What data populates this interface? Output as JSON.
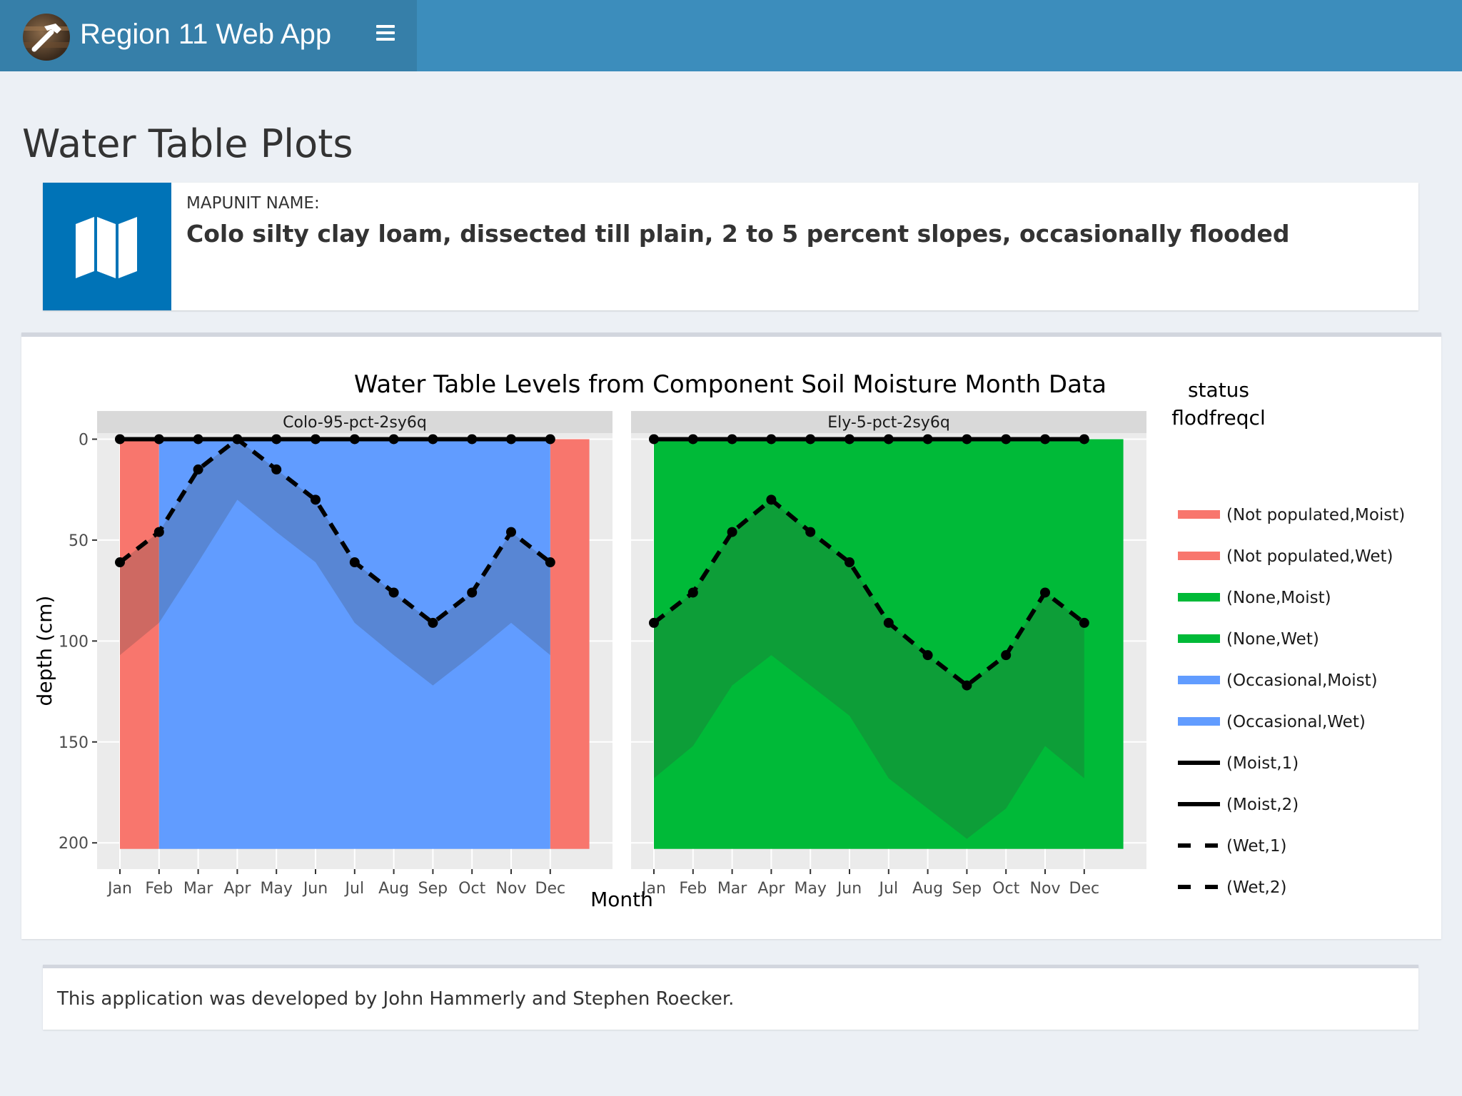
{
  "header": {
    "app_title": "Region 11 Web App",
    "logo_icon": "hammer-logo-icon",
    "menu_icon": "hamburger-menu-icon",
    "bar_color": "#3c8dbc",
    "brand_color": "#367fa9"
  },
  "page": {
    "title": "Water Table Plots"
  },
  "info_box": {
    "label": "Mapunit Name:",
    "value": "Colo silty clay loam, dissected till plain, 2 to 5 percent slopes, occasionally flooded",
    "icon": "map-icon",
    "icon_bg": "#0073b7"
  },
  "chart_data": {
    "type": "area",
    "title": "Water Table Levels from Component Soil Moisture Month Data",
    "xlabel": "Month",
    "ylabel": "depth (cm)",
    "y_ticks": [
      "0",
      "50",
      "100",
      "150",
      "200"
    ],
    "ylim": [
      -3,
      213
    ],
    "y_reversed": true,
    "categories": [
      "Jan",
      "Feb",
      "Mar",
      "Apr",
      "May",
      "Jun",
      "Jul",
      "Aug",
      "Sep",
      "Oct",
      "Nov",
      "Dec"
    ],
    "legend": {
      "title_line1": "status",
      "title_line2": "flodfreqcl",
      "position": "right",
      "items": [
        {
          "label": "(Not populated,Moist)",
          "kind": "fill",
          "color": "#f8766d"
        },
        {
          "label": "(Not populated,Wet)",
          "kind": "fill",
          "color": "#f8766d"
        },
        {
          "label": "(None,Moist)",
          "kind": "fill",
          "color": "#00ba38"
        },
        {
          "label": "(None,Wet)",
          "kind": "fill",
          "color": "#00ba38"
        },
        {
          "label": "(Occasional,Moist)",
          "kind": "fill",
          "color": "#619cff"
        },
        {
          "label": "(Occasional,Wet)",
          "kind": "fill",
          "color": "#619cff"
        },
        {
          "label": "(Moist,1)",
          "kind": "solid",
          "color": "#000000"
        },
        {
          "label": "(Moist,2)",
          "kind": "solid",
          "color": "#000000"
        },
        {
          "label": "(Wet,1)",
          "kind": "dashed",
          "color": "#000000"
        },
        {
          "label": "(Wet,2)",
          "kind": "dashed",
          "color": "#000000"
        }
      ]
    },
    "panels": [
      {
        "name": "Colo-95-pct-2sy6q",
        "bands": [
          {
            "status": "Not populated",
            "months": [
              "Jan",
              "Dec"
            ],
            "top": 0,
            "bottom": 203,
            "color": "#f8766d"
          },
          {
            "status": "Occasional",
            "months": [
              "Feb",
              "Mar",
              "Apr",
              "May",
              "Jun",
              "Jul",
              "Aug",
              "Sep",
              "Oct",
              "Nov"
            ],
            "top": 0,
            "bottom": 203,
            "color": "#619cff"
          }
        ],
        "moist_line": [
          0,
          0,
          0,
          0,
          0,
          0,
          0,
          0,
          0,
          0,
          0,
          0
        ],
        "wet_line": [
          61,
          46,
          15,
          0,
          15,
          30,
          61,
          76,
          91,
          76,
          46,
          61
        ],
        "wet_lower": [
          107,
          91,
          61,
          30,
          46,
          61,
          91,
          107,
          122,
          107,
          91,
          107
        ]
      },
      {
        "name": "Ely-5-pct-2sy6q",
        "bands": [
          {
            "status": "None",
            "months": [
              "Jan",
              "Feb",
              "Mar",
              "Apr",
              "May",
              "Jun",
              "Jul",
              "Aug",
              "Sep",
              "Oct",
              "Nov",
              "Dec"
            ],
            "top": 0,
            "bottom": 203,
            "color": "#00ba38"
          }
        ],
        "moist_line": [
          0,
          0,
          0,
          0,
          0,
          0,
          0,
          0,
          0,
          0,
          0,
          0
        ],
        "wet_line": [
          91,
          76,
          46,
          30,
          46,
          61,
          91,
          107,
          122,
          107,
          76,
          91
        ],
        "wet_lower": [
          168,
          152,
          122,
          107,
          122,
          137,
          168,
          183,
          198,
          183,
          152,
          168
        ]
      }
    ],
    "grid": true,
    "panel_background": "#ebebeb",
    "strip_background": "#d9d9d9"
  },
  "footer": {
    "text": "This application was developed by John Hammerly and Stephen Roecker."
  }
}
